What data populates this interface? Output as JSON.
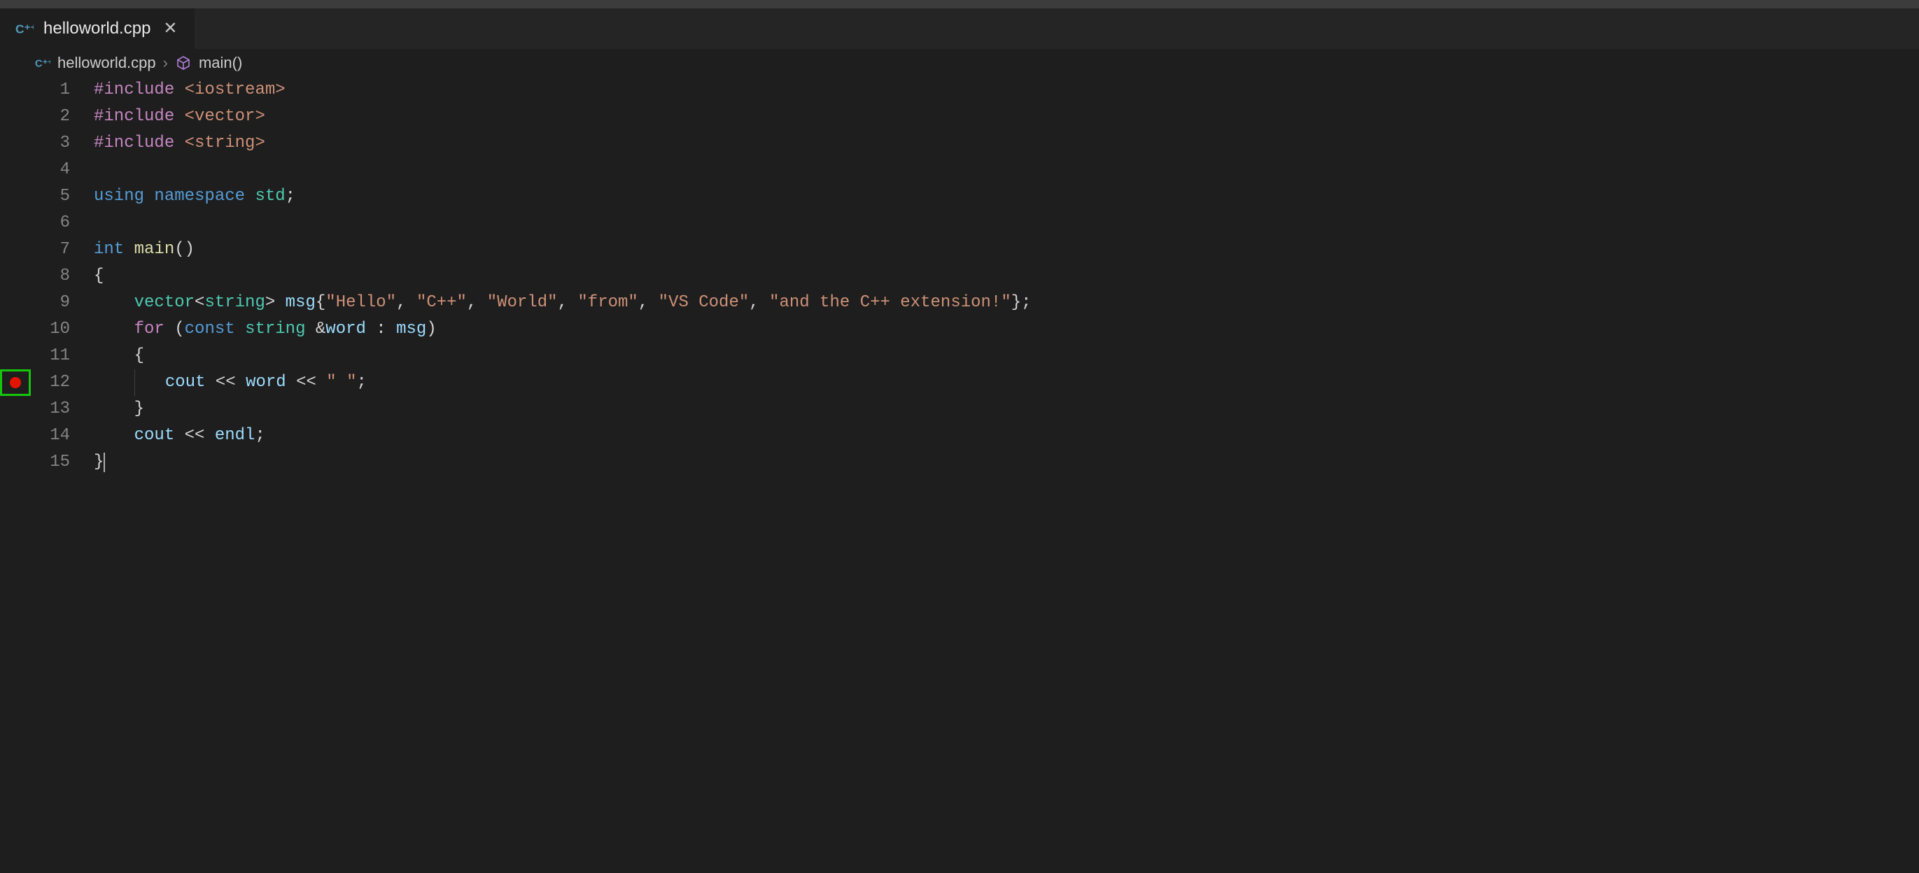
{
  "tab": {
    "filename": "helloworld.cpp"
  },
  "breadcrumb": {
    "file": "helloworld.cpp",
    "symbol": "main()"
  },
  "lines": [
    {
      "n": "1",
      "breakpoint": false,
      "tokens": [
        [
          "preproc",
          "#include"
        ],
        [
          "punc",
          " "
        ],
        [
          "include-path",
          "<iostream>"
        ]
      ]
    },
    {
      "n": "2",
      "breakpoint": false,
      "tokens": [
        [
          "preproc",
          "#include"
        ],
        [
          "punc",
          " "
        ],
        [
          "include-path",
          "<vector>"
        ]
      ]
    },
    {
      "n": "3",
      "breakpoint": false,
      "tokens": [
        [
          "preproc",
          "#include"
        ],
        [
          "punc",
          " "
        ],
        [
          "include-path",
          "<string>"
        ]
      ]
    },
    {
      "n": "4",
      "breakpoint": false,
      "tokens": []
    },
    {
      "n": "5",
      "breakpoint": false,
      "tokens": [
        [
          "keyword",
          "using"
        ],
        [
          "punc",
          " "
        ],
        [
          "keyword",
          "namespace"
        ],
        [
          "punc",
          " "
        ],
        [
          "type",
          "std"
        ],
        [
          "punc",
          ";"
        ]
      ]
    },
    {
      "n": "6",
      "breakpoint": false,
      "tokens": []
    },
    {
      "n": "7",
      "breakpoint": false,
      "tokens": [
        [
          "keyword",
          "int"
        ],
        [
          "punc",
          " "
        ],
        [
          "func",
          "main"
        ],
        [
          "punc",
          "()"
        ]
      ]
    },
    {
      "n": "8",
      "breakpoint": false,
      "tokens": [
        [
          "punc",
          "{"
        ]
      ]
    },
    {
      "n": "9",
      "breakpoint": false,
      "tokens": [
        [
          "punc",
          "    "
        ],
        [
          "type",
          "vector"
        ],
        [
          "punc",
          "<"
        ],
        [
          "type",
          "string"
        ],
        [
          "punc",
          "> "
        ],
        [
          "var",
          "msg"
        ],
        [
          "punc",
          "{"
        ],
        [
          "string",
          "\"Hello\""
        ],
        [
          "punc",
          ", "
        ],
        [
          "string",
          "\"C++\""
        ],
        [
          "punc",
          ", "
        ],
        [
          "string",
          "\"World\""
        ],
        [
          "punc",
          ", "
        ],
        [
          "string",
          "\"from\""
        ],
        [
          "punc",
          ", "
        ],
        [
          "string",
          "\"VS Code\""
        ],
        [
          "punc",
          ", "
        ],
        [
          "string",
          "\"and the C++ extension!\""
        ],
        [
          "punc",
          "};"
        ]
      ]
    },
    {
      "n": "10",
      "breakpoint": false,
      "tokens": [
        [
          "punc",
          "    "
        ],
        [
          "control",
          "for"
        ],
        [
          "punc",
          " ("
        ],
        [
          "keyword",
          "const"
        ],
        [
          "punc",
          " "
        ],
        [
          "type",
          "string"
        ],
        [
          "punc",
          " "
        ],
        [
          "op",
          "&"
        ],
        [
          "var",
          "word"
        ],
        [
          "punc",
          " : "
        ],
        [
          "var",
          "msg"
        ],
        [
          "punc",
          ")"
        ]
      ]
    },
    {
      "n": "11",
      "breakpoint": false,
      "tokens": [
        [
          "punc",
          "    {"
        ]
      ]
    },
    {
      "n": "12",
      "breakpoint": true,
      "highlight": true,
      "tokens": [
        [
          "punc",
          "    "
        ],
        [
          "guide",
          ""
        ],
        [
          "punc",
          "   "
        ],
        [
          "var",
          "cout"
        ],
        [
          "punc",
          " "
        ],
        [
          "op",
          "<<"
        ],
        [
          "punc",
          " "
        ],
        [
          "var",
          "word"
        ],
        [
          "punc",
          " "
        ],
        [
          "op",
          "<<"
        ],
        [
          "punc",
          " "
        ],
        [
          "string",
          "\" \""
        ],
        [
          "punc",
          ";"
        ]
      ]
    },
    {
      "n": "13",
      "breakpoint": false,
      "tokens": [
        [
          "punc",
          "    }"
        ]
      ]
    },
    {
      "n": "14",
      "breakpoint": false,
      "tokens": [
        [
          "punc",
          "    "
        ],
        [
          "var",
          "cout"
        ],
        [
          "punc",
          " "
        ],
        [
          "op",
          "<<"
        ],
        [
          "punc",
          " "
        ],
        [
          "var",
          "endl"
        ],
        [
          "punc",
          ";"
        ]
      ]
    },
    {
      "n": "15",
      "breakpoint": false,
      "cursor": true,
      "tokens": [
        [
          "punc",
          "}"
        ]
      ]
    }
  ]
}
